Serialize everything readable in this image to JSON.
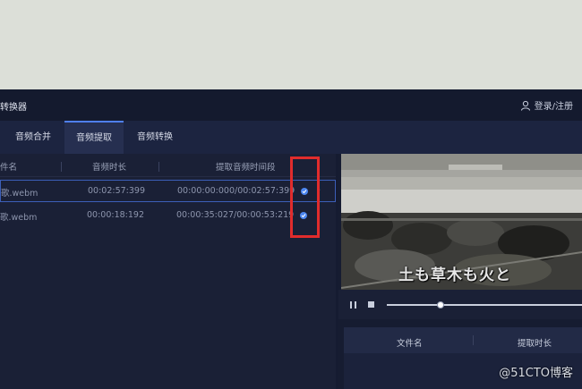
{
  "app": {
    "title": "转换器",
    "login": "登录/注册"
  },
  "tabs": [
    {
      "label": "音频合并",
      "active": false
    },
    {
      "label": "音频提取",
      "active": true
    },
    {
      "label": "音频转换",
      "active": false
    }
  ],
  "table": {
    "columns": [
      "件名",
      "音频时长",
      "提取音频时间段"
    ],
    "rows": [
      {
        "name": "歌.webm",
        "duration": "00:02:57:399",
        "segment": "00:00:00:000/00:02:57:399",
        "checked": true,
        "selected": true
      },
      {
        "name": "歌.webm",
        "duration": "00:00:18:192",
        "segment": "00:00:35:027/00:00:53:219",
        "checked": true,
        "selected": false
      }
    ]
  },
  "player": {
    "subtitle": "土も草木も火と",
    "progress": 0.27
  },
  "output_table": {
    "columns": [
      "文件名",
      "提取时长"
    ]
  },
  "watermark": "@51CTO博客",
  "colors": {
    "accent": "#4c86f0",
    "highlight_box": "#e12c2c",
    "background": "#151b31"
  }
}
